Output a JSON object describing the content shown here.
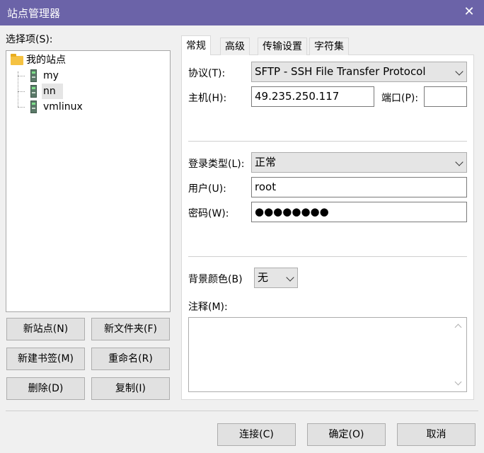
{
  "window": {
    "title": "站点管理器",
    "close_glyph": "✕"
  },
  "left": {
    "select_label": "选择项(S):",
    "tree": {
      "root": "我的站点",
      "sites": [
        "my",
        "nn",
        "vmlinux"
      ],
      "selected": "nn"
    },
    "buttons": {
      "new_site": "新站点(N)",
      "new_folder": "新文件夹(F)",
      "new_bookmark": "新建书签(M)",
      "rename": "重命名(R)",
      "delete": "删除(D)",
      "copy": "复制(I)"
    }
  },
  "tabs": [
    "常规",
    "高级",
    "传输设置",
    "字符集"
  ],
  "active_tab": "常规",
  "general": {
    "protocol_label": "协议(T):",
    "protocol_value": "SFTP - SSH File Transfer Protocol",
    "host_label": "主机(H):",
    "host_value": "49.235.250.117",
    "port_label": "端口(P):",
    "port_value": "",
    "logon_type_label": "登录类型(L):",
    "logon_type_value": "正常",
    "user_label": "用户(U):",
    "user_value": "root",
    "password_label": "密码(W):",
    "password_value": "●●●●●●●●",
    "bg_color_label": "背景颜色(B)",
    "bg_color_value": "无",
    "comments_label": "注释(M):",
    "comments_value": ""
  },
  "footer": {
    "connect": "连接(C)",
    "ok": "确定(O)",
    "cancel": "取消"
  },
  "colors": {
    "titlebar": "#6b63a8",
    "dialog_bg": "#f0f0f0"
  }
}
